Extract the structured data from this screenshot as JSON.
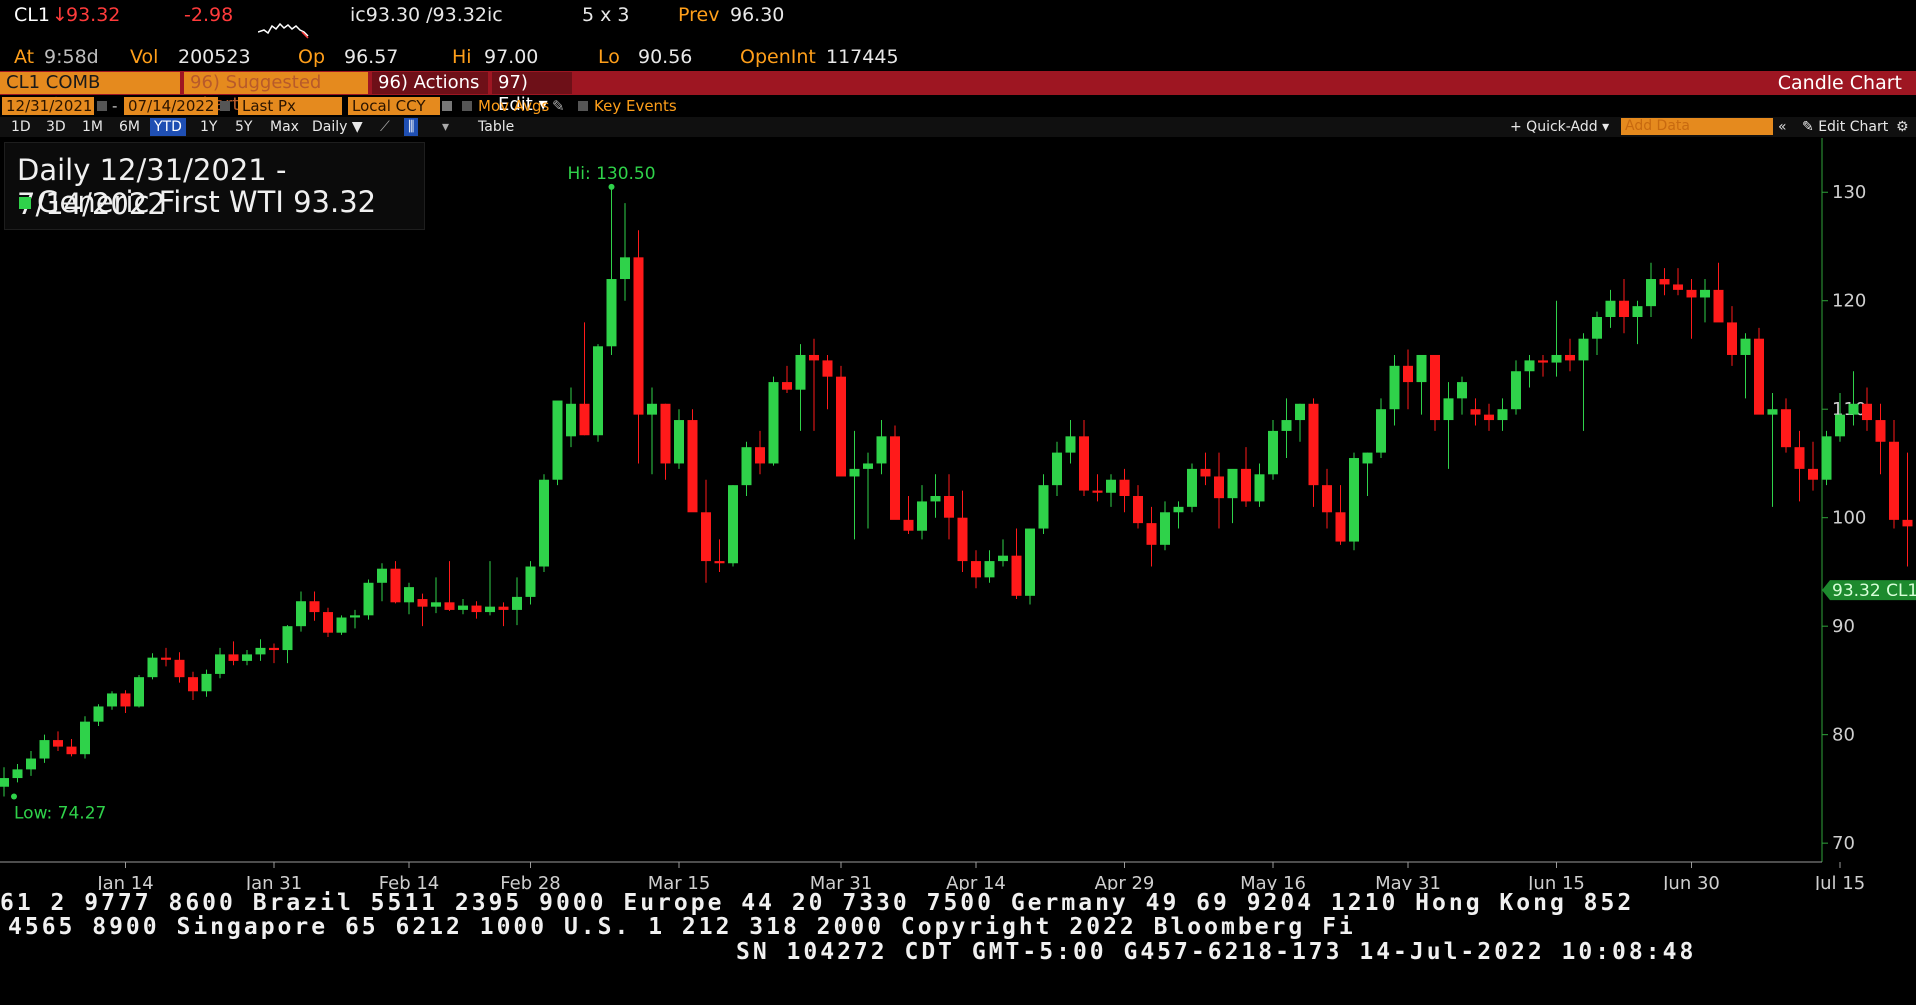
{
  "quote": {
    "ticker": "CL1",
    "arrow": "↓",
    "last": "93.32",
    "change": "-2.98",
    "bid_ask": "ic93.30 /93.32ic",
    "size": "5 x 3",
    "prev_label": "Prev",
    "prev": "96.30",
    "at_label": "At",
    "time": "9:58d",
    "vol_label": "Vol",
    "vol": "200523",
    "op_label": "Op",
    "op": "96.57",
    "hi_label": "Hi",
    "hi": "97.00",
    "lo_label": "Lo",
    "lo": "90.56",
    "oi_label": "OpenInt",
    "oi": "117445"
  },
  "toolbar": {
    "security": "CL1 COMB Comdty",
    "suggested": "96) Suggested Charts",
    "actions": "96) Actions ▾",
    "edit": "97) Edit ▾",
    "title": "Candle Chart",
    "start_date": "12/31/2021",
    "end_date": "07/14/2022",
    "field": "Last Px",
    "currency": "Local CCY",
    "mov_avgs": "Mov Avgs",
    "key_events": "Key Events",
    "periods": [
      "1D",
      "3D",
      "1M",
      "6M",
      "YTD",
      "1Y",
      "5Y",
      "Max"
    ],
    "selected_period": "YTD",
    "frequency": "Daily ▼",
    "table": "Table",
    "quick_add": "+ Quick-Add ▾",
    "add_data": "Add Data",
    "edit_chart": "Edit Chart"
  },
  "legend": {
    "range": "Daily 12/31/2021 - 7/14/2022",
    "series_label": "Generic First WTI 93.32"
  },
  "colors": {
    "up": "#2fd24a",
    "down": "#ff1a1a",
    "axis": "#2fa33a",
    "accent": "#e58a1e",
    "bar": "#9e1622"
  },
  "chart_data": {
    "type": "candlestick",
    "title": "Daily 12/31/2021 - 7/14/2022",
    "series_name": "Generic First WTI",
    "last_value": 93.32,
    "last_label": "93.32 CL1",
    "hi_annotation": "Hi: 130.50",
    "lo_annotation": "Low: 74.27",
    "ylim": [
      69,
      135
    ],
    "yticks": [
      70,
      80,
      90,
      100,
      110,
      120,
      130
    ],
    "xtick_labels": [
      "Jan 14",
      "Jan 31",
      "Feb 14",
      "Feb 28",
      "Mar 15",
      "Mar 31",
      "Apr 14",
      "Apr 29",
      "May 16",
      "May 31",
      "Jun 15",
      "Jun 30",
      "Jul 15"
    ],
    "xtick_index": [
      9,
      20,
      30,
      39,
      50,
      62,
      72,
      83,
      94,
      104,
      115,
      125,
      136
    ],
    "year_label": "2022",
    "ohlc": [
      [
        75.2,
        77.0,
        74.3,
        76.0
      ],
      [
        76.0,
        77.3,
        75.6,
        76.8
      ],
      [
        76.8,
        78.5,
        76.2,
        77.8
      ],
      [
        77.8,
        80.0,
        77.4,
        79.5
      ],
      [
        79.5,
        80.3,
        78.5,
        78.9
      ],
      [
        78.9,
        79.6,
        78.0,
        78.2
      ],
      [
        78.2,
        81.7,
        77.8,
        81.2
      ],
      [
        81.2,
        82.8,
        80.8,
        82.6
      ],
      [
        82.6,
        84.0,
        82.3,
        83.8
      ],
      [
        83.8,
        84.1,
        82.0,
        82.6
      ],
      [
        82.6,
        85.5,
        82.5,
        85.3
      ],
      [
        85.3,
        87.5,
        85.1,
        87.1
      ],
      [
        87.1,
        88.0,
        86.3,
        86.9
      ],
      [
        86.9,
        87.6,
        84.8,
        85.3
      ],
      [
        85.3,
        85.8,
        83.2,
        84.0
      ],
      [
        84.0,
        86.0,
        83.5,
        85.6
      ],
      [
        85.6,
        88.0,
        85.2,
        87.4
      ],
      [
        87.4,
        88.6,
        86.4,
        86.8
      ],
      [
        86.8,
        87.8,
        86.4,
        87.4
      ],
      [
        87.4,
        88.8,
        86.8,
        88.0
      ],
      [
        88.0,
        88.4,
        86.6,
        87.8
      ],
      [
        87.8,
        90.1,
        86.6,
        90.0
      ],
      [
        90.0,
        93.2,
        89.5,
        92.3
      ],
      [
        92.3,
        93.2,
        90.5,
        91.3
      ],
      [
        91.3,
        91.7,
        89.0,
        89.4
      ],
      [
        89.4,
        91.0,
        89.2,
        90.8
      ],
      [
        90.8,
        91.5,
        89.8,
        91.0
      ],
      [
        91.0,
        94.3,
        90.6,
        94.0
      ],
      [
        94.0,
        95.8,
        92.3,
        95.3
      ],
      [
        95.3,
        96.0,
        92.1,
        92.2
      ],
      [
        92.2,
        94.0,
        91.1,
        93.6
      ],
      [
        92.5,
        93.0,
        90.0,
        91.8
      ],
      [
        91.8,
        94.5,
        91.2,
        92.2
      ],
      [
        92.2,
        96.0,
        91.4,
        91.5
      ],
      [
        91.5,
        92.5,
        91.1,
        91.9
      ],
      [
        91.9,
        92.3,
        90.7,
        91.3
      ],
      [
        91.3,
        96.0,
        91.0,
        91.8
      ],
      [
        91.8,
        92.2,
        90.0,
        91.5
      ],
      [
        91.5,
        94.5,
        90.1,
        92.7
      ],
      [
        92.7,
        96.0,
        92.0,
        95.5
      ],
      [
        95.5,
        104.0,
        95.0,
        103.5
      ],
      [
        103.5,
        107.5,
        103.0,
        110.8
      ],
      [
        107.5,
        112.0,
        106.5,
        110.5
      ],
      [
        110.5,
        118.0,
        107.6,
        107.6
      ],
      [
        107.6,
        116.0,
        107.0,
        115.8
      ],
      [
        115.8,
        130.5,
        115.0,
        122.0
      ],
      [
        122.0,
        129.0,
        120.0,
        124.0
      ],
      [
        124.0,
        126.5,
        105.0,
        109.5
      ],
      [
        109.5,
        112.0,
        104.0,
        110.5
      ],
      [
        110.5,
        110.5,
        103.5,
        105.0
      ],
      [
        105.0,
        110.0,
        104.5,
        109.0
      ],
      [
        109.0,
        110.0,
        102.0,
        100.5
      ],
      [
        100.5,
        103.5,
        94.0,
        96.0
      ],
      [
        96.0,
        98.0,
        95.0,
        95.8
      ],
      [
        95.8,
        103.0,
        95.5,
        103.0
      ],
      [
        103.0,
        107.0,
        102.0,
        106.5
      ],
      [
        106.5,
        108.0,
        104.0,
        105.0
      ],
      [
        105.0,
        113.0,
        104.8,
        112.5
      ],
      [
        112.5,
        114.0,
        111.5,
        111.8
      ],
      [
        111.8,
        116.0,
        108.0,
        115.0
      ],
      [
        115.0,
        116.5,
        108.0,
        114.5
      ],
      [
        114.5,
        115.0,
        110.0,
        113.0
      ],
      [
        113.0,
        114.0,
        104.0,
        103.8
      ],
      [
        103.8,
        108.0,
        98.0,
        104.5
      ],
      [
        104.5,
        106.0,
        99.0,
        105.0
      ],
      [
        105.0,
        109.0,
        104.0,
        107.5
      ],
      [
        107.5,
        108.5,
        100.0,
        99.8
      ],
      [
        99.8,
        102.0,
        98.5,
        98.8
      ],
      [
        98.8,
        103.0,
        98.0,
        101.5
      ],
      [
        101.5,
        104.0,
        100.0,
        102.0
      ],
      [
        102.0,
        104.0,
        98.0,
        100.0
      ],
      [
        100.0,
        102.5,
        95.0,
        96.0
      ],
      [
        96.0,
        97.0,
        93.5,
        94.5
      ],
      [
        94.5,
        97.0,
        94.0,
        96.0
      ],
      [
        96.0,
        98.0,
        95.5,
        96.5
      ],
      [
        96.5,
        99.0,
        92.5,
        92.8
      ],
      [
        92.8,
        99.0,
        92.0,
        99.0
      ],
      [
        99.0,
        104.0,
        98.5,
        103.0
      ],
      [
        103.0,
        107.0,
        102.0,
        106.0
      ],
      [
        106.0,
        109.0,
        105.0,
        107.5
      ],
      [
        107.5,
        109.0,
        102.0,
        102.5
      ],
      [
        102.5,
        104.0,
        101.5,
        102.3
      ],
      [
        102.3,
        104.0,
        101.0,
        103.5
      ],
      [
        103.5,
        104.5,
        100.5,
        102.0
      ],
      [
        102.0,
        103.0,
        99.0,
        99.5
      ],
      [
        99.5,
        101.0,
        95.5,
        97.5
      ],
      [
        97.5,
        101.5,
        97.0,
        100.5
      ],
      [
        100.5,
        101.5,
        99.0,
        101.0
      ],
      [
        101.0,
        105.0,
        100.5,
        104.5
      ],
      [
        104.5,
        106.0,
        103.0,
        103.8
      ],
      [
        103.8,
        106.0,
        99.0,
        101.8
      ],
      [
        101.8,
        104.0,
        99.5,
        104.5
      ],
      [
        104.5,
        106.5,
        101.0,
        101.5
      ],
      [
        101.5,
        105.0,
        101.0,
        104.0
      ],
      [
        104.0,
        109.0,
        103.5,
        108.0
      ],
      [
        108.0,
        111.0,
        105.5,
        109.0
      ],
      [
        109.0,
        110.5,
        107.0,
        110.5
      ],
      [
        110.5,
        111.0,
        101.0,
        103.0
      ],
      [
        103.0,
        104.5,
        99.0,
        100.5
      ],
      [
        100.5,
        103.0,
        97.5,
        97.8
      ],
      [
        97.8,
        106.0,
        97.0,
        105.5
      ],
      [
        105.0,
        106.0,
        102.0,
        106.0
      ],
      [
        106.0,
        111.0,
        105.5,
        110.0
      ],
      [
        110.0,
        115.0,
        108.5,
        114.0
      ],
      [
        114.0,
        115.5,
        110.0,
        112.5
      ],
      [
        112.5,
        115.0,
        109.5,
        115.0
      ],
      [
        115.0,
        115.0,
        108.0,
        109.0
      ],
      [
        109.0,
        112.5,
        104.5,
        111.0
      ],
      [
        111.0,
        113.0,
        109.5,
        112.5
      ],
      [
        110.0,
        111.0,
        108.5,
        109.5
      ],
      [
        109.5,
        110.5,
        108.0,
        109.0
      ],
      [
        109.0,
        111.0,
        108.0,
        110.0
      ],
      [
        110.0,
        114.5,
        109.5,
        113.5
      ],
      [
        113.5,
        115.0,
        112.0,
        114.5
      ],
      [
        114.5,
        115.0,
        113.0,
        114.3
      ],
      [
        114.3,
        120.0,
        113.0,
        115.0
      ],
      [
        115.0,
        116.5,
        113.5,
        114.5
      ],
      [
        114.5,
        117.0,
        108.0,
        116.5
      ],
      [
        116.5,
        119.0,
        115.0,
        118.5
      ],
      [
        118.5,
        121.0,
        117.5,
        120.0
      ],
      [
        120.0,
        122.0,
        117.0,
        118.5
      ],
      [
        118.5,
        120.0,
        116.0,
        119.5
      ],
      [
        119.5,
        123.5,
        118.5,
        122.0
      ],
      [
        122.0,
        123.0,
        120.5,
        121.5
      ],
      [
        121.5,
        123.0,
        120.5,
        121.0
      ],
      [
        121.0,
        122.0,
        116.5,
        120.3
      ],
      [
        120.3,
        122.0,
        118.0,
        121.0
      ],
      [
        121.0,
        123.5,
        118.5,
        118.0
      ],
      [
        118.0,
        119.5,
        114.0,
        115.0
      ],
      [
        115.0,
        117.0,
        111.0,
        116.5
      ],
      [
        116.5,
        117.5,
        110.0,
        109.5
      ],
      [
        109.5,
        111.5,
        101.0,
        110.0
      ],
      [
        110.0,
        111.0,
        106.0,
        106.5
      ],
      [
        106.5,
        108.0,
        101.5,
        104.5
      ],
      [
        104.5,
        107.0,
        102.5,
        103.5
      ],
      [
        103.5,
        108.0,
        103.0,
        107.5
      ],
      [
        107.5,
        111.5,
        107.0,
        109.5
      ],
      [
        109.5,
        113.5,
        108.5,
        110.5
      ],
      [
        110.5,
        112.0,
        108.0,
        109.0
      ],
      [
        109.0,
        110.5,
        104.0,
        107.0
      ],
      [
        107.0,
        109.0,
        99.0,
        99.8
      ],
      [
        99.8,
        106.0,
        95.5,
        99.2
      ],
      [
        99.2,
        101.0,
        97.0,
        98.0
      ],
      [
        98.0,
        103.0,
        97.5,
        102.5
      ],
      [
        102.5,
        105.0,
        102.0,
        104.5
      ],
      [
        104.5,
        105.0,
        103.0,
        104.0
      ],
      [
        104.0,
        104.5,
        95.0,
        95.8
      ],
      [
        95.8,
        97.0,
        94.0,
        96.3
      ],
      [
        96.3,
        97.0,
        90.56,
        93.32
      ]
    ]
  },
  "footer": {
    "line1": "61 2 9777 8600 Brazil 5511 2395 9000 Europe 44 20 7330 7500 Germany 49 69 9204 1210 Hong Kong 852",
    "line2": "4565 8900       Singapore 65 6212 1000       U.S. 1 212 318 2000         Copyright 2022 Bloomberg Fi",
    "line3": "SN 104272 CDT  GMT-5:00 G457-6218-173 14-Jul-2022 10:08:48"
  }
}
